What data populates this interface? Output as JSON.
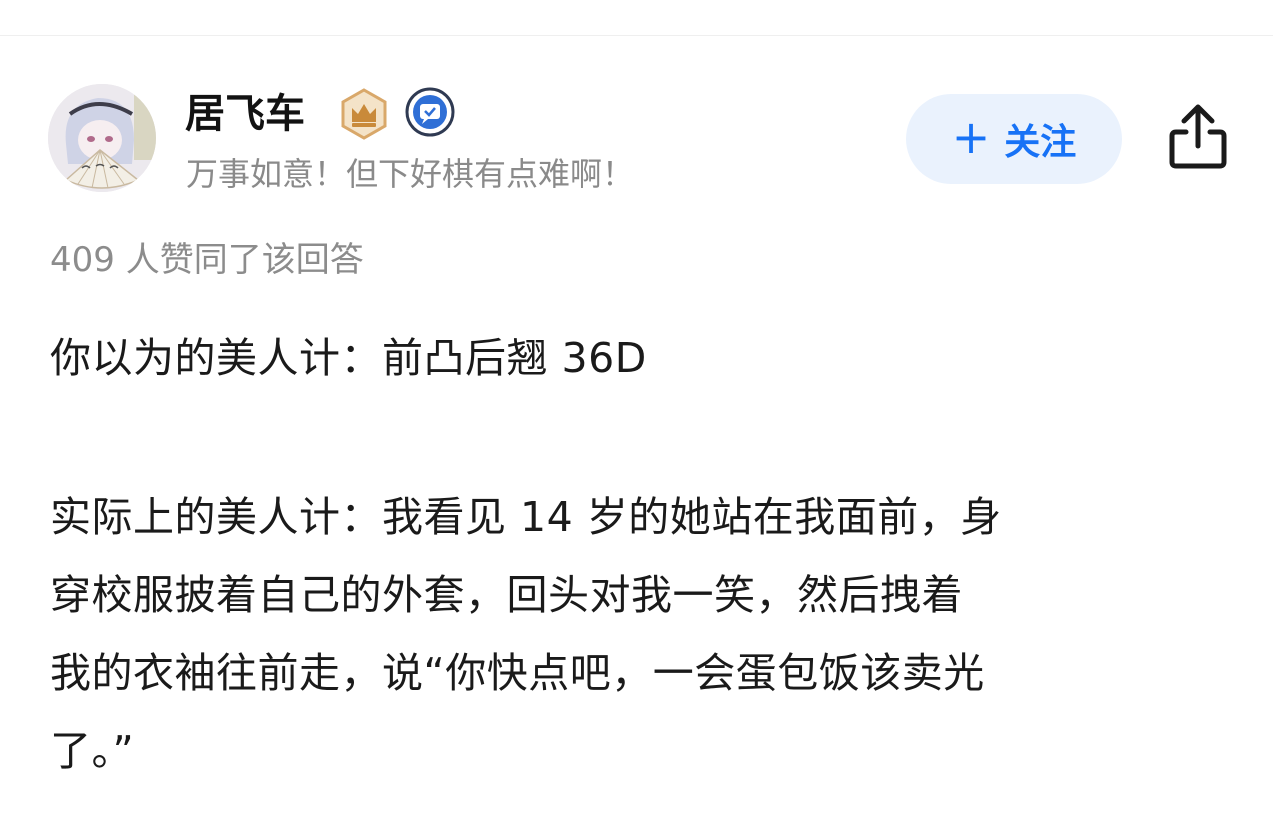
{
  "author": {
    "name": "居飞车",
    "bio": "万事如意！但下好棋有点难啊！",
    "avatar_icon": "anime-girl-avatar",
    "badges": [
      "crown-badge-icon",
      "verified-badge-icon"
    ]
  },
  "follow": {
    "plus": "+",
    "label": "关注"
  },
  "share_icon": "share-icon",
  "stats": {
    "upvotes_text": "409 人赞同了该回答"
  },
  "answer": {
    "para1": "你以为的美人计：前凸后翘 36D",
    "para2_lines": [
      "实际上的美人计：我看见 14 岁的她站在我面前，身",
      "穿校服披着自己的外套，回头对我一笑，然后拽着",
      "我的衣袖往前走，说“你快点吧，一会蛋包饭该卖光",
      "了。”"
    ]
  },
  "colors": {
    "accent": "#1772f6",
    "follow_bg": "#eaf2fd",
    "muted_text": "#8a8a8a"
  }
}
